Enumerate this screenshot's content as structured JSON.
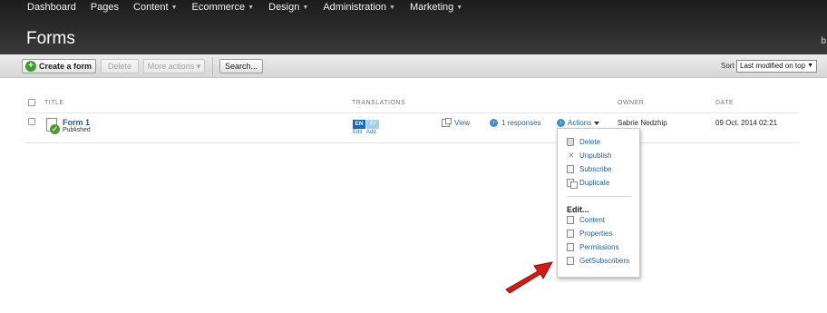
{
  "nav": {
    "items": [
      {
        "label": "Dashboard",
        "has_menu": false
      },
      {
        "label": "Pages",
        "has_menu": false
      },
      {
        "label": "Content",
        "has_menu": true
      },
      {
        "label": "Ecommerce",
        "has_menu": true
      },
      {
        "label": "Design",
        "has_menu": true
      },
      {
        "label": "Administration",
        "has_menu": true
      },
      {
        "label": "Marketing",
        "has_menu": true
      }
    ],
    "caret": "▼"
  },
  "page": {
    "title": "Forms",
    "edge_glyph": "b"
  },
  "toolbar": {
    "create_label": "Create a form",
    "create_icon": "+",
    "delete_label": "Delete",
    "more_label": "More actions ▾",
    "search_label": "Search...",
    "sort_label": "Sort",
    "sort_value": "Last modified on top",
    "sort_arrow": "▼"
  },
  "table": {
    "headers": {
      "title": "TITLE",
      "translations": "TRANSLATIONS",
      "owner": "OWNER",
      "date": "DATE"
    },
    "rows": [
      {
        "title": "Form 1",
        "status": "Published",
        "lang_primary": "EN",
        "lang_secondary": "FI",
        "lang_edit": "Edit",
        "lang_add": "Add",
        "view_label": "View",
        "responses_label": "1 responses",
        "actions_label": "Actions",
        "owner": "Sabrie Nedzhip",
        "date": "09 Oct. 2014 02:21"
      }
    ]
  },
  "actions_menu": {
    "items": [
      {
        "label": "Delete",
        "icon": "trash-icon"
      },
      {
        "label": "Unpublish",
        "icon": "x-icon"
      },
      {
        "label": "Subscribe",
        "icon": "document-icon"
      },
      {
        "label": "Duplicate",
        "icon": "duplicate-icon"
      }
    ],
    "edit_heading": "Edit...",
    "edit_items": [
      {
        "label": "Content",
        "icon": "document-icon"
      },
      {
        "label": "Properties",
        "icon": "document-icon"
      },
      {
        "label": "Permissions",
        "icon": "document-icon"
      },
      {
        "label": "GetSubscribers",
        "icon": "document-icon"
      }
    ]
  },
  "colors": {
    "header_dark": "#2b2b2b",
    "link_blue": "#1e5d9c",
    "accent_green": "#3f9d2f",
    "arrow_red": "#d41b14"
  }
}
